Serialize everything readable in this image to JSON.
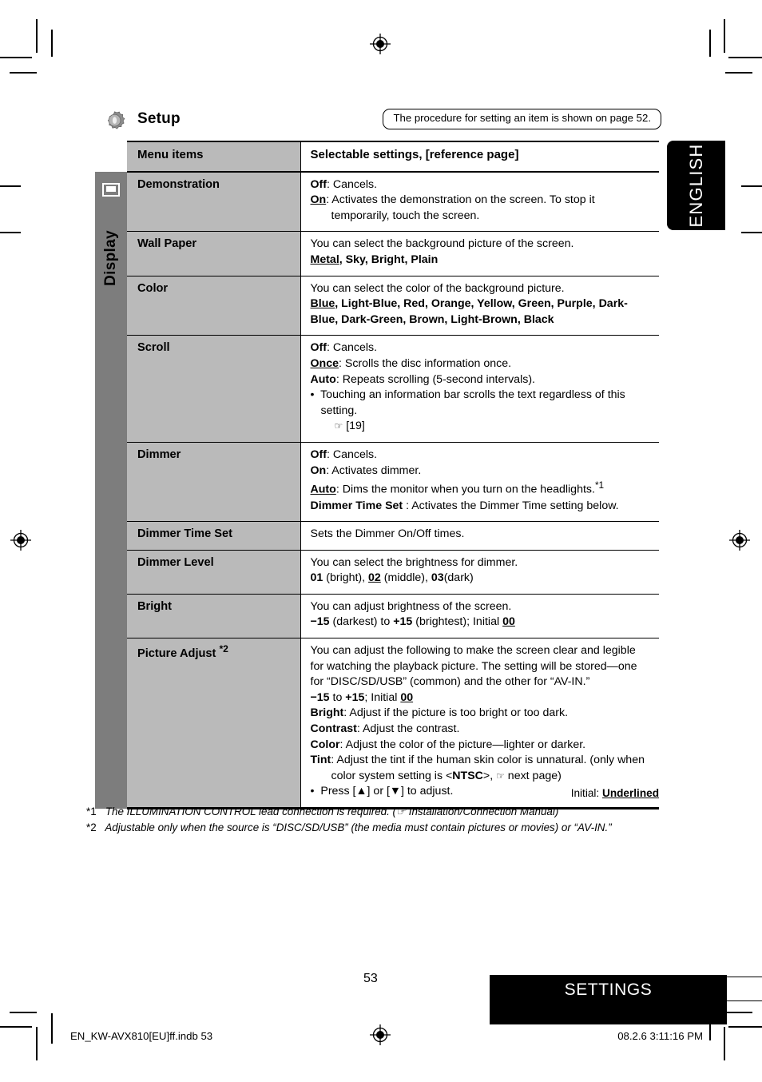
{
  "lang_tab": {
    "label": "ENGLISH"
  },
  "header": {
    "icon": "gear-icon",
    "title": "Setup",
    "callout": "The procedure for setting an item is shown on page 52."
  },
  "side_band": {
    "icon": "monitor-icon",
    "label": "Display"
  },
  "table": {
    "columns": [
      "Menu items",
      "Selectable settings, [reference page]"
    ],
    "rows": [
      {
        "menu": "Demonstration",
        "lines": [
          {
            "type": "setting",
            "bold": "Off",
            "underline": false,
            "text": ": Cancels."
          },
          {
            "type": "setting-indent",
            "bold": "On",
            "underline": true,
            "text": ": Activates the demonstration on the screen. To stop it temporarily, touch the screen."
          }
        ]
      },
      {
        "menu": "Wall Paper",
        "lines": [
          {
            "type": "plain",
            "text": "You can select the background picture of the screen."
          },
          {
            "type": "options",
            "underlined_first": "Metal",
            "rest": ", Sky, Bright, Plain"
          }
        ]
      },
      {
        "menu": "Color",
        "lines": [
          {
            "type": "plain",
            "text": "You can select the color of the background picture."
          },
          {
            "type": "options",
            "underlined_first": "Blue",
            "rest": ", Light-Blue, Red, Orange, Yellow, Green, Purple, Dark-Blue, Dark-Green, Brown, Light-Brown, Black"
          }
        ]
      },
      {
        "menu": "Scroll",
        "lines": [
          {
            "type": "setting",
            "bold": "Off",
            "underline": false,
            "text": ": Cancels."
          },
          {
            "type": "setting",
            "bold": "Once",
            "underline": true,
            "text": ": Scrolls the disc information once."
          },
          {
            "type": "setting",
            "bold": "Auto",
            "underline": false,
            "text": ": Repeats scrolling (5-second intervals)."
          },
          {
            "type": "bullet",
            "text": "Touching an information bar scrolls the text regardless of this setting."
          },
          {
            "type": "ref",
            "text": "[19]"
          }
        ]
      },
      {
        "menu": "Dimmer",
        "lines": [
          {
            "type": "setting",
            "bold": "Off",
            "underline": false,
            "text": ": Cancels."
          },
          {
            "type": "setting",
            "bold": "On",
            "underline": false,
            "text": ": Activates dimmer."
          },
          {
            "type": "setting",
            "bold": "Auto",
            "underline": true,
            "text": ": Dims the monitor when you turn on the headlights.*1"
          },
          {
            "type": "setting",
            "bold": "Dimmer Time Set",
            "underline": false,
            "text": " : Activates the Dimmer Time setting below."
          }
        ]
      },
      {
        "menu": "Dimmer Time Set",
        "lines": [
          {
            "type": "plain",
            "text": "Sets the Dimmer On/Off times."
          }
        ]
      },
      {
        "menu": "Dimmer Level",
        "lines": [
          {
            "type": "plain",
            "text": "You can select the brightness for dimmer."
          },
          {
            "type": "levels",
            "text": "01 (bright), 02 (middle), 03(dark)"
          }
        ]
      },
      {
        "menu": "Bright",
        "lines": [
          {
            "type": "plain",
            "text": "You can adjust brightness of the screen."
          },
          {
            "type": "range",
            "text": "−15 (darkest) to +15 (brightest); Initial 00"
          }
        ]
      },
      {
        "menu": "Picture Adjust *2",
        "lines": [
          {
            "type": "plain",
            "text": "You can adjust the following to make the screen clear and legible for watching the playback picture. The setting will be stored—one for “DISC/SD/USB” (common) and the other for “AV-IN.”"
          },
          {
            "type": "range",
            "text": "−15 to +15; Initial 00"
          },
          {
            "type": "setting",
            "bold": "Bright",
            "underline": false,
            "text": ": Adjust if the picture is too bright or too dark."
          },
          {
            "type": "setting",
            "bold": "Contrast",
            "underline": false,
            "text": ": Adjust the contrast."
          },
          {
            "type": "setting",
            "bold": "Color",
            "underline": false,
            "text": ": Adjust the color of the picture—lighter or darker."
          },
          {
            "type": "setting-indent",
            "bold": "Tint",
            "underline": false,
            "text": ": Adjust the tint if the human skin color is unnatural. (only when color system setting is <NTSC>, ☞ next page)"
          },
          {
            "type": "bullet",
            "text": "Press [▲] or [▼] to adjust."
          }
        ]
      }
    ]
  },
  "notes": {
    "initial_label": "Initial: ",
    "initial_value": "Underlined",
    "footnote_1_mark": "*1",
    "footnote_1": "The ILLUMINATION CONTROL lead connection is required. (☞ Installation/Connection Manual)",
    "footnote_2_mark": "*2",
    "footnote_2": "Adjustable only when the source is “DISC/SD/USB” (the media must contain pictures or movies) or “AV-IN.”"
  },
  "footer": {
    "page_number": "53",
    "banner": "SETTINGS",
    "indb_file": "EN_KW-AVX810[EU]ff.indb   53",
    "timestamp": "08.2.6   3:11:16 PM"
  },
  "colors": {
    "band_gray": "#7d7d7d",
    "menu_gray": "#bababa",
    "black": "#000000",
    "white": "#ffffff"
  }
}
